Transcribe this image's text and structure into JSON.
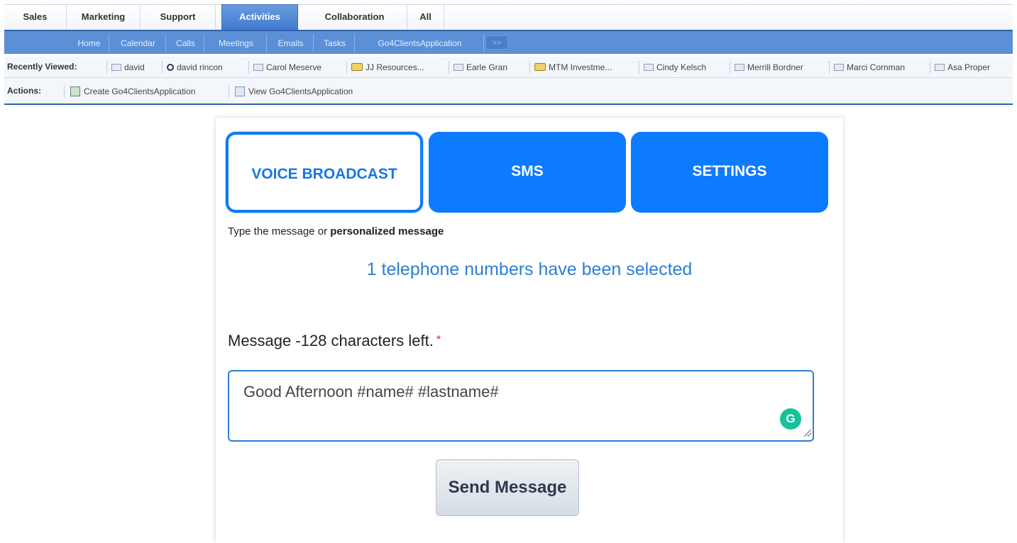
{
  "module_tabs": [
    {
      "label": "Sales"
    },
    {
      "label": "Marketing"
    },
    {
      "label": "Support"
    },
    {
      "label": "Activities",
      "active": true
    },
    {
      "label": "Collaboration"
    },
    {
      "label": "All"
    }
  ],
  "subnav": {
    "items": [
      "Home",
      "Calendar",
      "Calls",
      "Meetings",
      "Emails",
      "Tasks",
      "Go4ClientsApplication"
    ],
    "more_label": ">>"
  },
  "recently_viewed": {
    "label": "Recently Viewed:",
    "items": [
      "david",
      "david rincon",
      "Carol Meserve",
      "JJ Resources...",
      "Earle Gran",
      "MTM Investme...",
      "Cindy Kelsch",
      "Merrill Bordner",
      "Marci Cornman",
      "Asa Proper"
    ]
  },
  "actions": {
    "label": "Actions:",
    "create": "Create Go4ClientsApplication",
    "view": "View Go4ClientsApplication"
  },
  "panel": {
    "tabs": {
      "voice": "VOICE BROADCAST",
      "sms": "SMS",
      "settings": "SETTINGS"
    },
    "hint_prefix": "Type the message or",
    "hint_bold": "personalized message",
    "selected_message": "1 telephone numbers have been selected",
    "message_label": "Message -128 characters left.",
    "required_mark": "*",
    "message_value": "Good Afternoon #name# #lastname#",
    "grammarly_letter": "G",
    "send_label": "Send Message"
  },
  "colors": {
    "primary_blue": "#0d7bff",
    "nav_blue": "#5b8fd6",
    "info_text": "#2b7fd2",
    "required": "#e02424",
    "grammarly": "#15c39a"
  }
}
